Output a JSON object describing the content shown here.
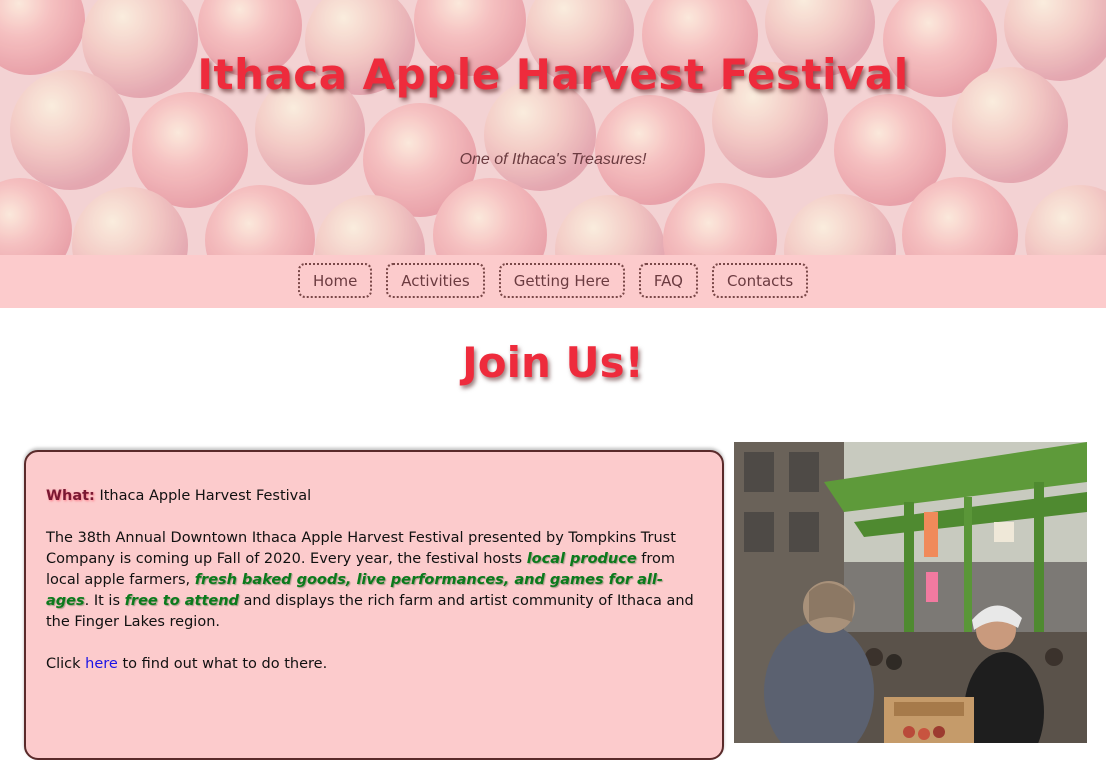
{
  "hero": {
    "title": "Ithaca Apple Harvest Festival",
    "tagline": "One of Ithaca's Treasures!"
  },
  "nav": {
    "items": [
      "Home",
      "Activities",
      "Getting Here",
      "FAQ",
      "Contacts"
    ]
  },
  "main": {
    "heading": "Join Us!",
    "what_label": "What:",
    "what_value": "Ithaca Apple Harvest Festival",
    "intro_1": "The 38th Annual Downtown Ithaca Apple Harvest Festival presented by Tompkins Trust Company is coming up Fall of 2020. Every year, the festival hosts ",
    "highlight_1": "local produce",
    "intro_2": " from local apple farmers, ",
    "highlight_2": "fresh baked goods, live performances, and games for all-ages",
    "intro_3": ". It is ",
    "highlight_3": "free to attend",
    "intro_4": " and displays the rich farm and artist community of Ithaca and the Finger Lakes region.",
    "click_prefix": "Click ",
    "click_link": "here",
    "click_suffix": " to find out what to do there."
  },
  "colors": {
    "accent_red": "#ee2b3c",
    "nav_background": "#fccbcc",
    "highlight_green": "#0b7a1c",
    "link_blue": "#1a14e6"
  }
}
